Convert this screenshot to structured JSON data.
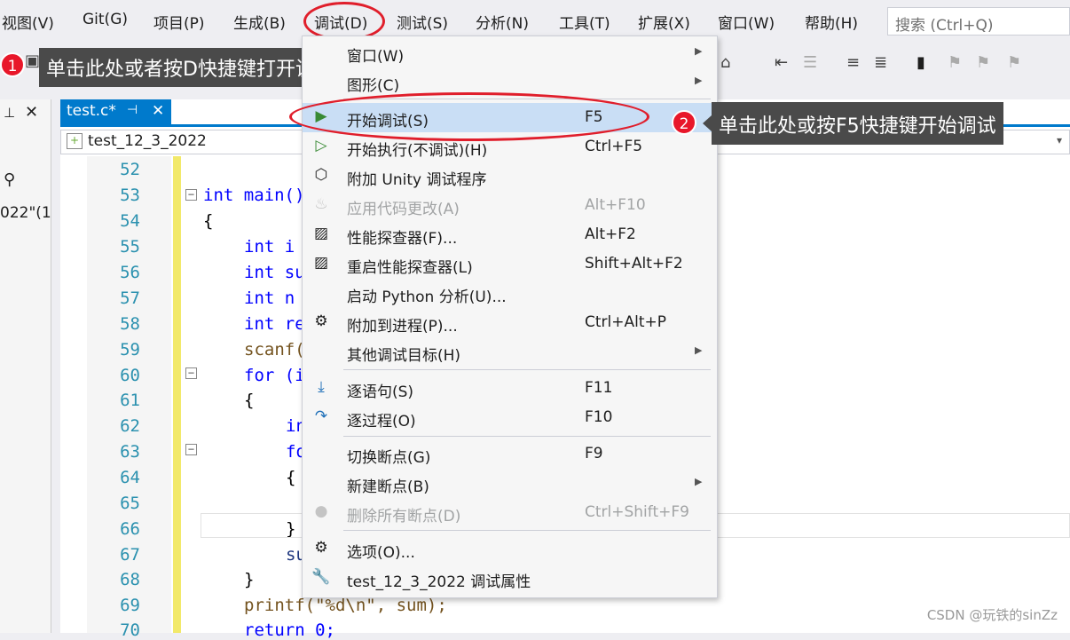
{
  "menubar": {
    "items": [
      "视图(V)",
      "Git(G)",
      "项目(P)",
      "生成(B)",
      "调试(D)",
      "测试(S)",
      "分析(N)",
      "工具(T)",
      "扩展(X)",
      "窗口(W)",
      "帮助(H)"
    ],
    "search_placeholder": "搜索 (Ctrl+Q)"
  },
  "annotations": {
    "step1_num": "1",
    "step1_text": "单击此处或者按D快捷键打开调试菜单",
    "step2_num": "2",
    "step2_text": "单击此处或按F5快捷键开始调试"
  },
  "editor": {
    "tab_label": "test.c*",
    "tab_pin": "⊣",
    "tab_close": "✕",
    "nav_scope": "test_12_3_2022",
    "left_panel_text": "022\"(1",
    "line_numbers": [
      "52",
      "53",
      "54",
      "55",
      "56",
      "57",
      "58",
      "59",
      "60",
      "61",
      "62",
      "63",
      "64",
      "65",
      "66",
      "67",
      "68",
      "69",
      "70"
    ],
    "code": {
      "l53": "int main()",
      "l54": "{",
      "l55": "int i",
      "l56": "int su",
      "l57": "int n",
      "l58": "int re",
      "l59": "scanf(",
      "l60": "for (i",
      "l61": "{",
      "l62": "in",
      "l63": "fo",
      "l64": "{",
      "l66": "}",
      "l67": "su",
      "l68": "}",
      "l69": "printf(\"%d\\n\", sum);",
      "l70": "return 0;"
    }
  },
  "debug_menu": {
    "items": [
      {
        "label": "窗口(W)",
        "shortcut": "",
        "icon": "",
        "submenu": true
      },
      {
        "label": "图形(C)",
        "shortcut": "",
        "icon": "",
        "submenu": true
      },
      {
        "label": "开始调试(S)",
        "shortcut": "F5",
        "icon": "play-icon"
      },
      {
        "label": "开始执行(不调试)(H)",
        "shortcut": "Ctrl+F5",
        "icon": "play-outline-icon"
      },
      {
        "label": "附加 Unity 调试程序",
        "shortcut": "",
        "icon": "cube-icon"
      },
      {
        "label": "应用代码更改(A)",
        "shortcut": "Alt+F10",
        "icon": "flame-icon",
        "disabled": true
      },
      {
        "label": "性能探查器(F)...",
        "shortcut": "Alt+F2",
        "icon": "chart-icon"
      },
      {
        "label": "重启性能探查器(L)",
        "shortcut": "Shift+Alt+F2",
        "icon": "chart-icon"
      },
      {
        "label": "启动 Python 分析(U)...",
        "shortcut": "",
        "icon": ""
      },
      {
        "label": "附加到进程(P)...",
        "shortcut": "Ctrl+Alt+P",
        "icon": "gears-icon"
      },
      {
        "label": "其他调试目标(H)",
        "shortcut": "",
        "icon": "",
        "submenu": true
      },
      {
        "label": "逐语句(S)",
        "shortcut": "F11",
        "icon": "step-into-icon"
      },
      {
        "label": "逐过程(O)",
        "shortcut": "F10",
        "icon": "step-over-icon"
      },
      {
        "label": "切换断点(G)",
        "shortcut": "F9",
        "icon": ""
      },
      {
        "label": "新建断点(B)",
        "shortcut": "",
        "icon": "",
        "submenu": true
      },
      {
        "label": "删除所有断点(D)",
        "shortcut": "Ctrl+Shift+F9",
        "icon": "breakpoints-icon",
        "disabled": true
      },
      {
        "label": "选项(O)...",
        "shortcut": "",
        "icon": "gear-icon"
      },
      {
        "label": "test_12_3_2022 调试属性",
        "shortcut": "",
        "icon": "wrench-icon"
      }
    ]
  },
  "watermark": "CSDN @玩铁的sinZz",
  "colors": {
    "accent": "#007acc",
    "highlight": "#c9def5",
    "annotation_red": "#e01e2b"
  }
}
